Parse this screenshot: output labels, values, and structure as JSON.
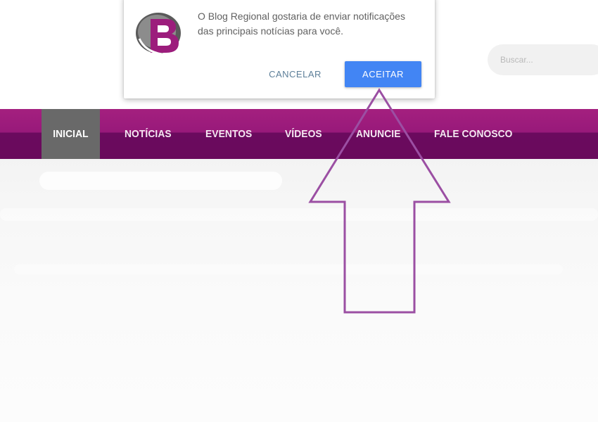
{
  "search": {
    "placeholder": "Buscar..."
  },
  "nav": {
    "items": [
      {
        "label": "INICIAL",
        "active": true
      },
      {
        "label": "NOTÍCIAS",
        "active": false
      },
      {
        "label": "EVENTOS",
        "active": false
      },
      {
        "label": "VÍDEOS",
        "active": false
      },
      {
        "label": "ANUNCIE",
        "active": false
      },
      {
        "label": "FALE CONOSCO",
        "active": false
      }
    ]
  },
  "notification": {
    "message": "O Blog Regional gostaria de enviar notificações das principais notícias para você.",
    "cancel_label": "CANCELAR",
    "accept_label": "ACEITAR",
    "logo_letter": "B"
  },
  "colors": {
    "brand_purple": "#98197a",
    "brand_purple_dark": "#690a5c",
    "active_tab": "#696969",
    "accept_blue": "#4285f4",
    "arrow_stroke": "#9b4fa3"
  },
  "icons": {
    "logo": "blog-regional-logo-icon",
    "arrow": "up-arrow-annotation"
  }
}
